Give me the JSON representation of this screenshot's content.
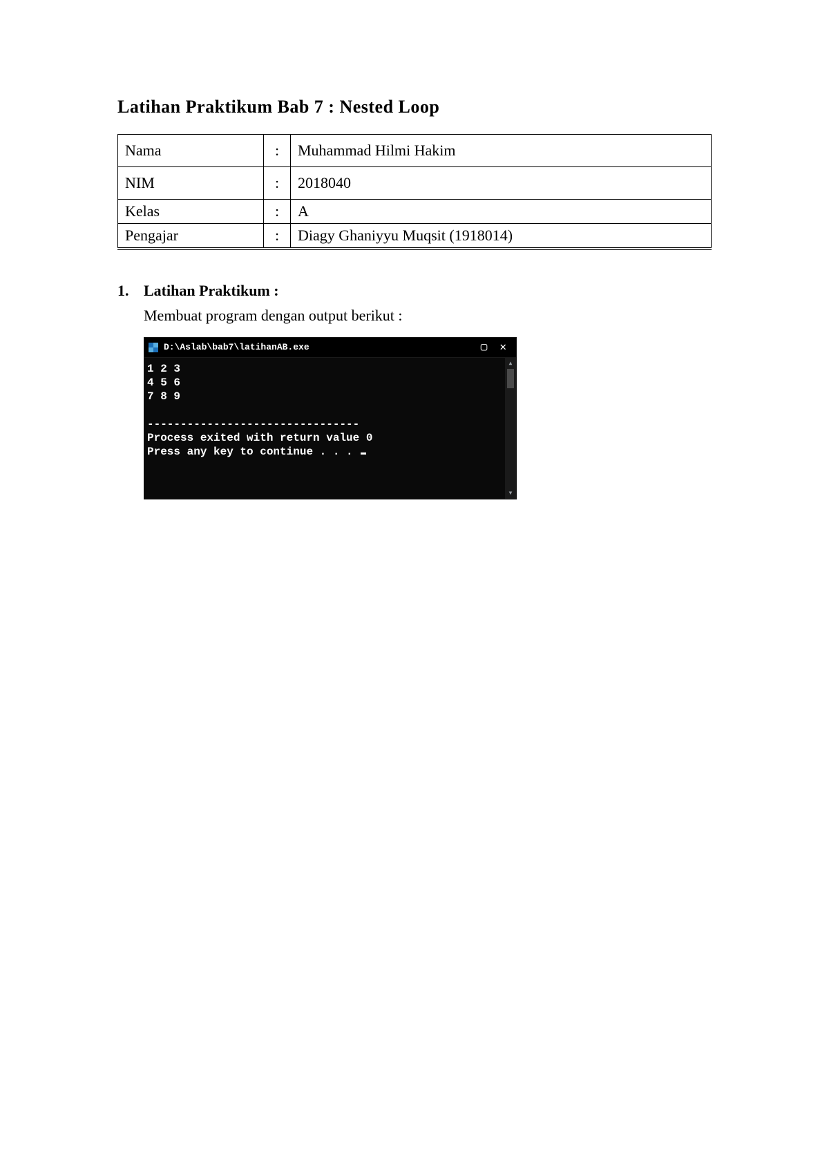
{
  "title": "Latihan Praktikum Bab 7 : Nested Loop",
  "info": {
    "rows": [
      {
        "label": "Nama",
        "value": "Muhammad Hilmi Hakim",
        "tall": true
      },
      {
        "label": "NIM",
        "value": "2018040",
        "tall": true
      },
      {
        "label": "Kelas",
        "value": "A",
        "tall": false
      },
      {
        "label": "Pengajar",
        "value": "Diagy Ghaniyyu Muqsit (1918014)",
        "tall": false
      }
    ],
    "colon": ":"
  },
  "section": {
    "number": "1.",
    "heading": "Latihan Praktikum :",
    "description": "Membuat program dengan output berikut :"
  },
  "console": {
    "title": "D:\\Aslab\\bab7\\latihanAB.exe",
    "lines": [
      "1 2 3",
      "4 5 6",
      "7 8 9",
      "",
      "--------------------------------",
      "Process exited with return value 0",
      "Press any key to continue . . . "
    ]
  }
}
